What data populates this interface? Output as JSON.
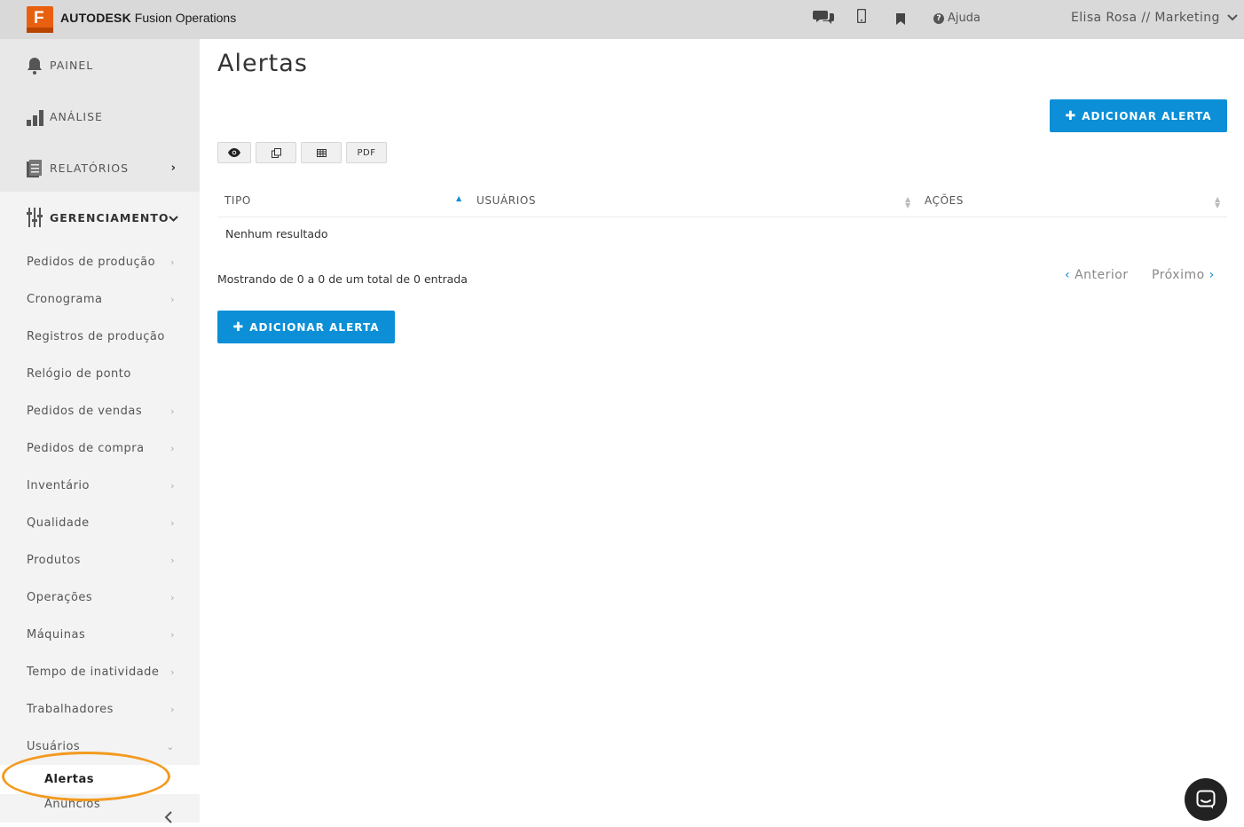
{
  "header": {
    "logo_letter": "F",
    "brand_main": "AUTODESK",
    "brand_product": "Fusion Operations",
    "help_label": "Ajuda",
    "user_label": "Elisa Rosa // Marketing"
  },
  "sidebar": {
    "main_items": [
      {
        "label": "PAINEL",
        "icon": "bell-icon"
      },
      {
        "label": "ANÁLISE",
        "icon": "bar-chart-icon"
      },
      {
        "label": "RELATÓRIOS",
        "icon": "document-icon"
      }
    ],
    "management": {
      "label": "GERENCIAMENTO",
      "icon": "sliders-icon"
    },
    "sub_items": [
      "Pedidos de produção",
      "Cronograma",
      "Registros de produção",
      "Relógio de ponto",
      "Pedidos de vendas",
      "Pedidos de compra",
      "Inventário",
      "Qualidade",
      "Produtos",
      "Operações",
      "Máquinas",
      "Tempo de inatividade",
      "Trabalhadores",
      "Usuários"
    ],
    "children": [
      "Alertas",
      "Anúncios"
    ]
  },
  "main": {
    "title": "Alertas",
    "add_button_label": "ADICIONAR ALERTA",
    "toolbar": {
      "pdf_label": "PDF"
    },
    "table": {
      "columns": [
        "TIPO",
        "USUÁRIOS",
        "AÇÕES"
      ],
      "empty_text": "Nenhum resultado"
    },
    "info_text": "Mostrando de 0 a 0 de um total de 0 entrada",
    "pager": {
      "prev": "Anterior",
      "next": "Próximo"
    }
  },
  "colors": {
    "accent": "#0c8fd6",
    "logo": "#e8600f",
    "highlight_oval": "#f39a1e",
    "topbar": "#d9d9d9"
  }
}
